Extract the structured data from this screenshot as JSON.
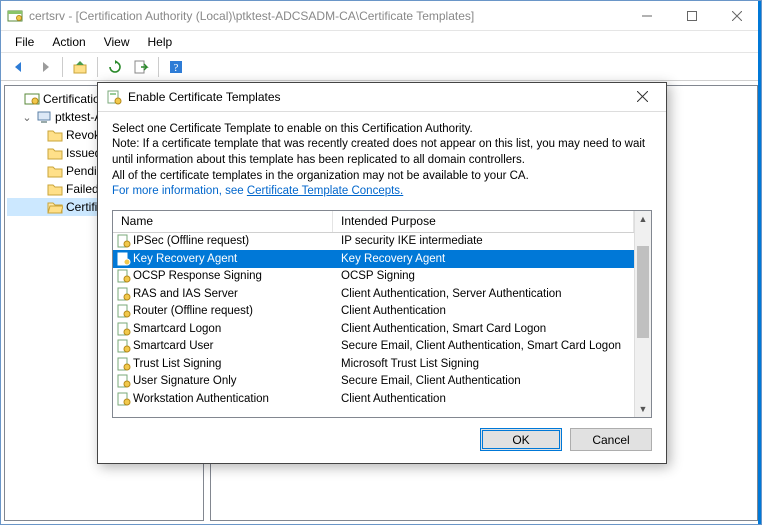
{
  "window": {
    "title": "certsrv - [Certification Authority (Local)\\ptktest-ADCSADM-CA\\Certificate Templates]"
  },
  "menubar": {
    "file": "File",
    "action": "Action",
    "view": "View",
    "help": "Help"
  },
  "tree": {
    "root": "Certification Authority (Local)",
    "ca": "ptktest-ADCSADM-CA",
    "folders": {
      "revoked": "Revoked Certificates",
      "issued": "Issued Certificates",
      "pending": "Pending Requests",
      "failed": "Failed Requests",
      "templates": "Certificate Templates"
    }
  },
  "dialog": {
    "title": "Enable Certificate Templates",
    "intro1": "Select one Certificate Template to enable on this Certification Authority.",
    "intro2": "Note: If a certificate template that was recently created does not appear on this list, you may need to wait until information about this template has been replicated to all domain controllers.",
    "intro3": "All of the certificate templates in the organization may not be available to your CA.",
    "link_prefix": "For more information, see ",
    "link_text": "Certificate Template Concepts.",
    "col_name": "Name",
    "col_purpose": "Intended Purpose",
    "rows": [
      {
        "name": "IPSec (Offline request)",
        "purpose": "IP security IKE intermediate",
        "selected": false
      },
      {
        "name": "Key Recovery Agent",
        "purpose": "Key Recovery Agent",
        "selected": true
      },
      {
        "name": "OCSP Response Signing",
        "purpose": "OCSP Signing",
        "selected": false
      },
      {
        "name": "RAS and IAS Server",
        "purpose": "Client Authentication, Server Authentication",
        "selected": false
      },
      {
        "name": "Router (Offline request)",
        "purpose": "Client Authentication",
        "selected": false
      },
      {
        "name": "Smartcard Logon",
        "purpose": "Client Authentication, Smart Card Logon",
        "selected": false
      },
      {
        "name": "Smartcard User",
        "purpose": "Secure Email, Client Authentication, Smart Card Logon",
        "selected": false
      },
      {
        "name": "Trust List Signing",
        "purpose": "Microsoft Trust List Signing",
        "selected": false
      },
      {
        "name": "User Signature Only",
        "purpose": "Secure Email, Client Authentication",
        "selected": false
      },
      {
        "name": "Workstation Authentication",
        "purpose": "Client Authentication",
        "selected": false
      }
    ],
    "ok": "OK",
    "cancel": "Cancel"
  }
}
